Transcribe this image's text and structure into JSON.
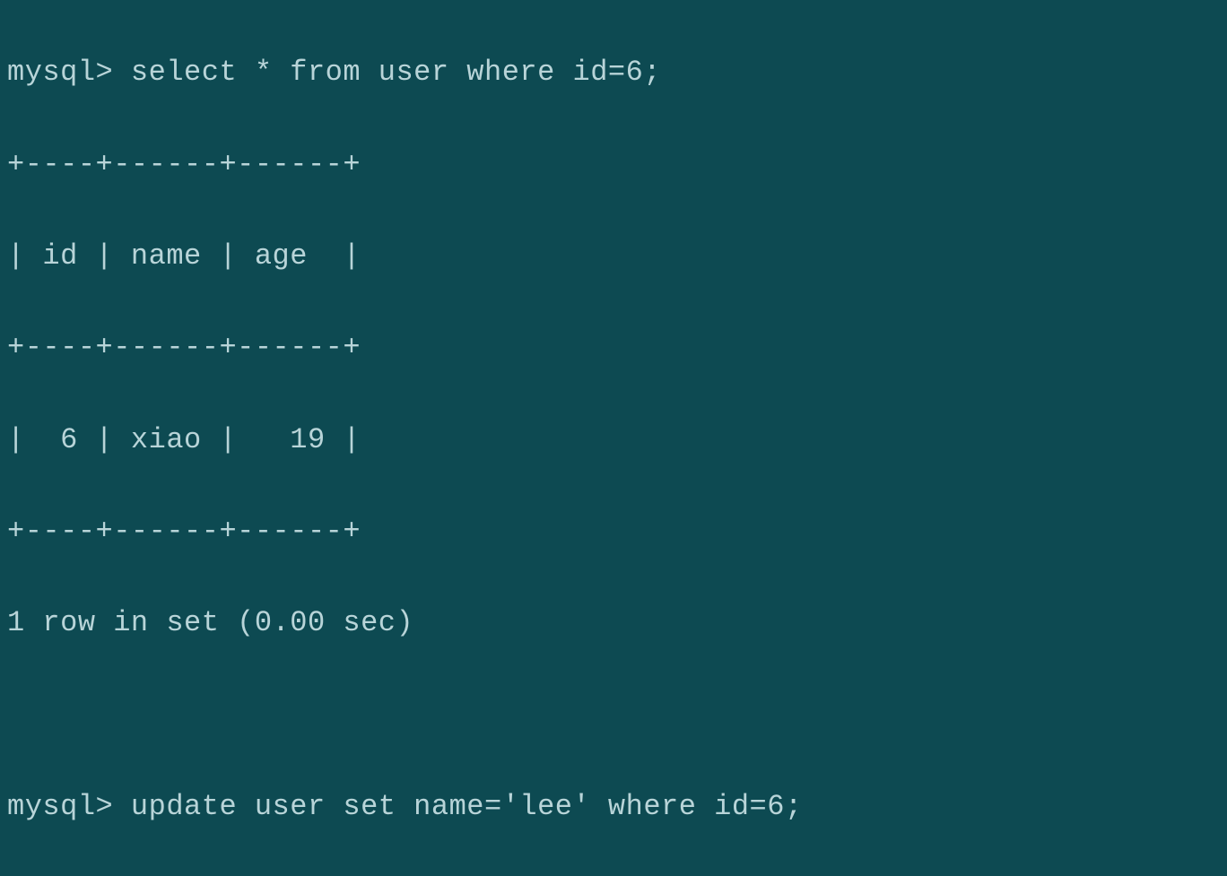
{
  "terminal": {
    "prompt": "mysql>",
    "query1": "select * from user where id=6;",
    "table": {
      "border_top": "+----+------+------+",
      "headers": "| id | name | age  |",
      "border_mid": "+----+------+------+",
      "row1": "|  6 | xiao |   19 |",
      "border_bottom": "+----+------+------+"
    },
    "status1": "1 row in set (0.00 sec)",
    "query2": "update user set name='lee' where id=6;"
  },
  "chart_data": {
    "type": "table",
    "title": "select * from user where id=6;",
    "columns": [
      "id",
      "name",
      "age"
    ],
    "rows": [
      {
        "id": 6,
        "name": "xiao",
        "age": 19
      }
    ],
    "row_count": 1,
    "query_time_sec": 0.0
  }
}
